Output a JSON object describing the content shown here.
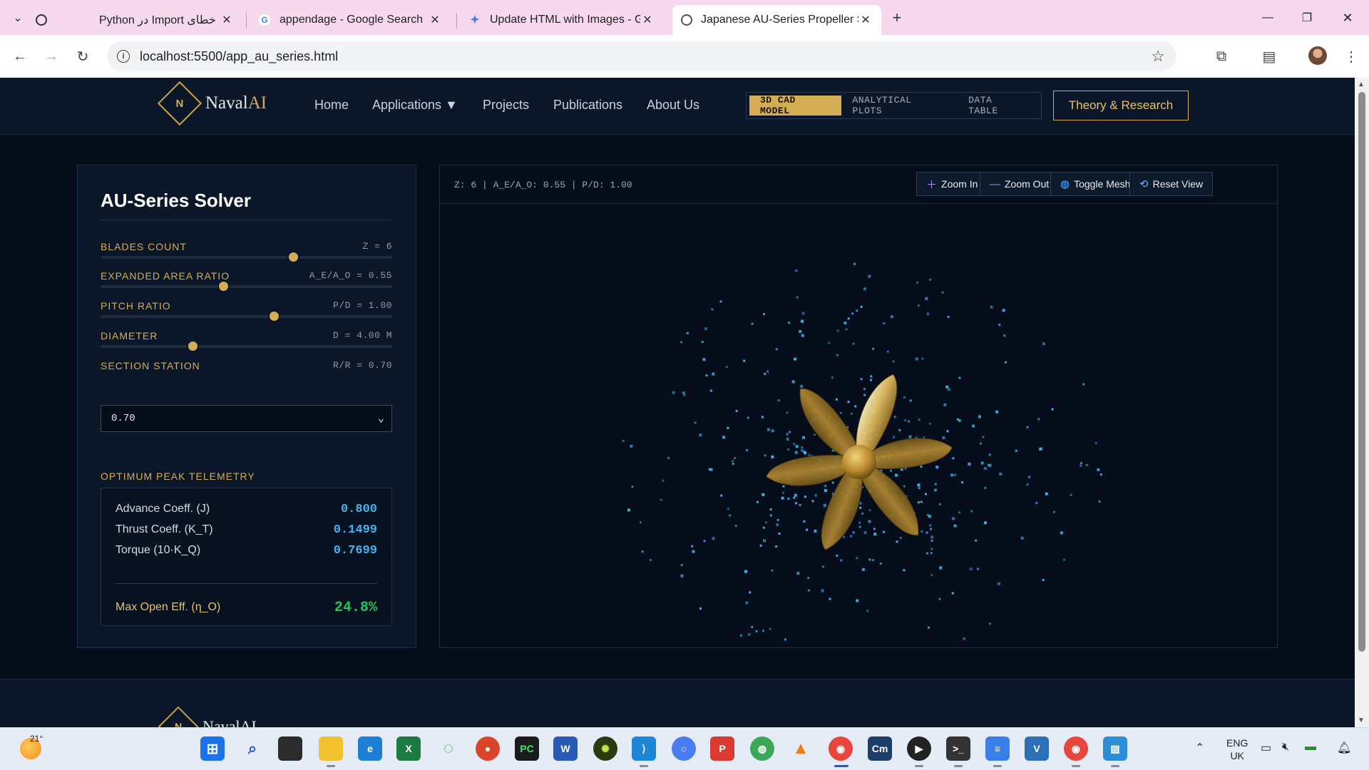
{
  "browser": {
    "tabs": [
      {
        "title": "Python در Import خطای",
        "icon": "chatgpt-icon",
        "active": false
      },
      {
        "title": "appendage - Google Search",
        "icon": "google-icon",
        "active": false
      },
      {
        "title": "Update HTML with Images - Go",
        "icon": "gemini-icon",
        "active": false
      },
      {
        "title": "Japanese AU-Series Propeller Sc",
        "icon": "globe-icon",
        "active": true
      }
    ],
    "url": "localhost:5500/app_au_series.html"
  },
  "site": {
    "logo_letter": "N",
    "logo_text_a": "Naval",
    "logo_text_b": "AI",
    "nav": [
      "Home",
      "Applications ▼",
      "Projects",
      "Publications",
      "About Us"
    ],
    "view_modes": [
      "3D CAD MODEL",
      "ANALYTICAL PLOTS",
      "DATA TABLE"
    ],
    "active_view": "3D CAD MODEL",
    "cta": "Theory & Research"
  },
  "solver": {
    "title": "AU-Series Solver",
    "params": [
      {
        "label": "BLADES COUNT",
        "value": "Z = 6",
        "position": 0.66
      },
      {
        "label": "EXPANDED AREA RATIO",
        "value": "A_E/A_O = 0.55",
        "position": 0.42
      },
      {
        "label": "PITCH RATIO",
        "value": "P/D = 1.00",
        "position": 0.595
      },
      {
        "label": "DIAMETER",
        "value": "D = 4.00 M",
        "position": 0.315
      },
      {
        "label": "SECTION STATION",
        "value": "R/R = 0.70"
      }
    ],
    "section_select": "0.70",
    "telemetry_label": "OPTIMUM PEAK TELEMETRY",
    "telemetry": [
      {
        "key": "Advance Coeff. (J)",
        "value": "0.800"
      },
      {
        "key": "Thrust Coeff. (K_T)",
        "value": "0.1499"
      },
      {
        "key": "Torque (10·K_Q)",
        "value": "0.7699"
      }
    ],
    "efficiency": {
      "key": "Max Open Eff. (η_O)",
      "value": "24.8%"
    }
  },
  "viewer": {
    "status": "Z: 6 | A_E/A_O: 0.55 | P/D: 1.00",
    "buttons": [
      {
        "label": "Zoom In",
        "icon": "plus-icon"
      },
      {
        "label": "Zoom Out",
        "icon": "minus-icon"
      },
      {
        "label": "Toggle Mesh",
        "icon": "globe-icon"
      },
      {
        "label": "Reset View",
        "icon": "reset-icon"
      }
    ],
    "blade_count": 6,
    "colors": {
      "blade": "#c9a24a",
      "particles": "#3fb6f2"
    }
  },
  "footer": {
    "logo_letter": "N",
    "logo_text": "NavalAI"
  },
  "taskbar": {
    "temperature": "21°",
    "lang_line1": "ENG",
    "lang_line2": "UK"
  }
}
